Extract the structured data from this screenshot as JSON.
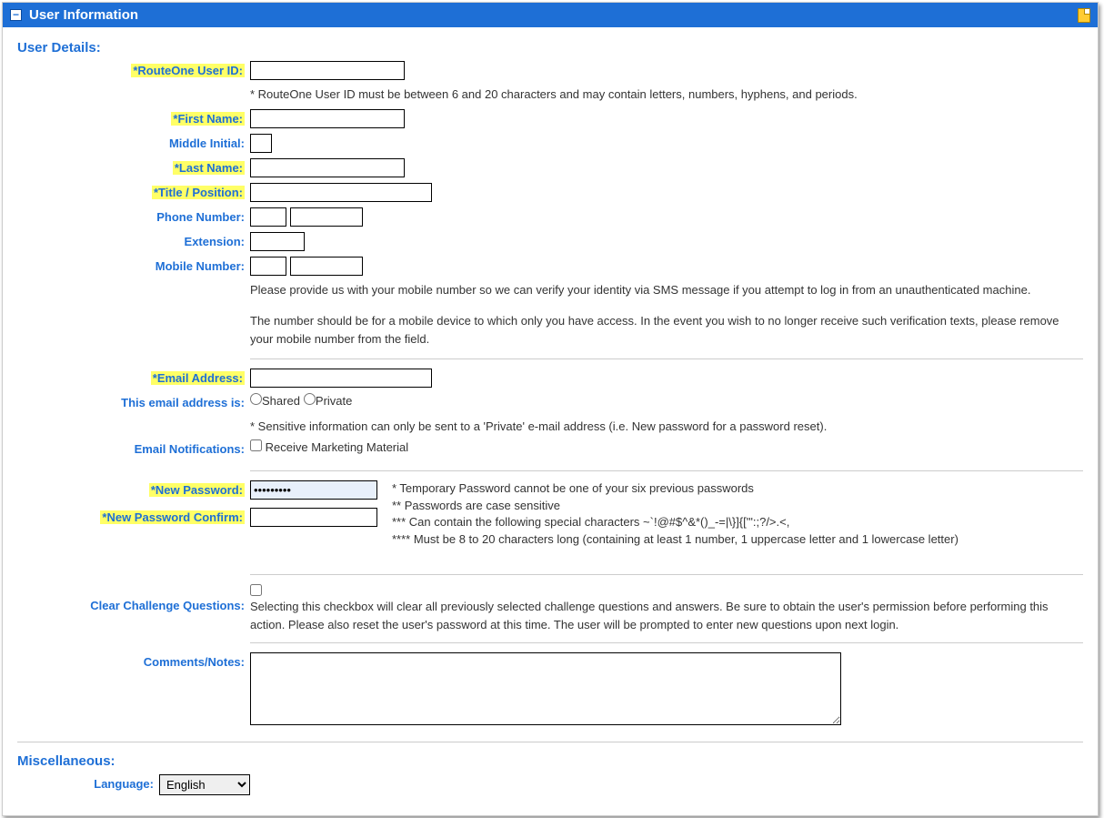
{
  "panel": {
    "title": "User Information"
  },
  "sections": {
    "userDetails": "User Details:",
    "misc": "Miscellaneous:"
  },
  "labels": {
    "routeOneUserId": "*RouteOne User ID:",
    "firstName": "*First Name:",
    "middleInitial": "Middle Initial:",
    "lastName": "*Last Name:",
    "titlePosition": "*Title / Position:",
    "phoneNumber": "Phone Number:",
    "extension": "Extension:",
    "mobileNumber": "Mobile Number:",
    "emailAddress": "*Email Address:",
    "emailType": "This email address is:",
    "emailNotifications": "Email Notifications:",
    "newPassword": "*New Password:",
    "newPasswordConfirm": "*New Password Confirm:",
    "clearChallenge": "Clear Challenge Questions:",
    "comments": "Comments/Notes:",
    "language": "Language:"
  },
  "helpers": {
    "userIdRule": "* RouteOne User ID must be between 6 and 20 characters and may contain letters, numbers, hyphens, and periods.",
    "mobile1": "Please provide us with your mobile number so we can verify your identity via SMS message if you attempt to log in from an unauthenticated machine.",
    "mobile2": "The number should be for a mobile device to which only you have access. In the event you wish to no longer receive such verification texts, please remove your mobile number from the field.",
    "emailPrivacy": "* Sensitive information can only be sent to a 'Private' e-mail address (i.e. New password for a password reset).",
    "marketing": "Receive Marketing Material",
    "pw1": "* Temporary Password cannot be one of your six previous passwords",
    "pw2": "** Passwords are case sensitive",
    "pw3": "*** Can contain the following special characters ~`!@#$^&*()_-=|\\}]{['\":;?/>.<,",
    "pw4": "**** Must be 8 to 20 characters long (containing at least 1 number, 1 uppercase letter and 1 lowercase letter)",
    "clearChallengeText": "Selecting this checkbox will clear all previously selected challenge questions and answers. Be sure to obtain the user's permission before performing this action. Please also reset the user's password at this time. The user will be prompted to enter new questions upon next login."
  },
  "radios": {
    "shared": "Shared",
    "private": "Private"
  },
  "values": {
    "newPassword": "•••••••••"
  },
  "language": {
    "selected": "English",
    "options": [
      "English"
    ]
  }
}
